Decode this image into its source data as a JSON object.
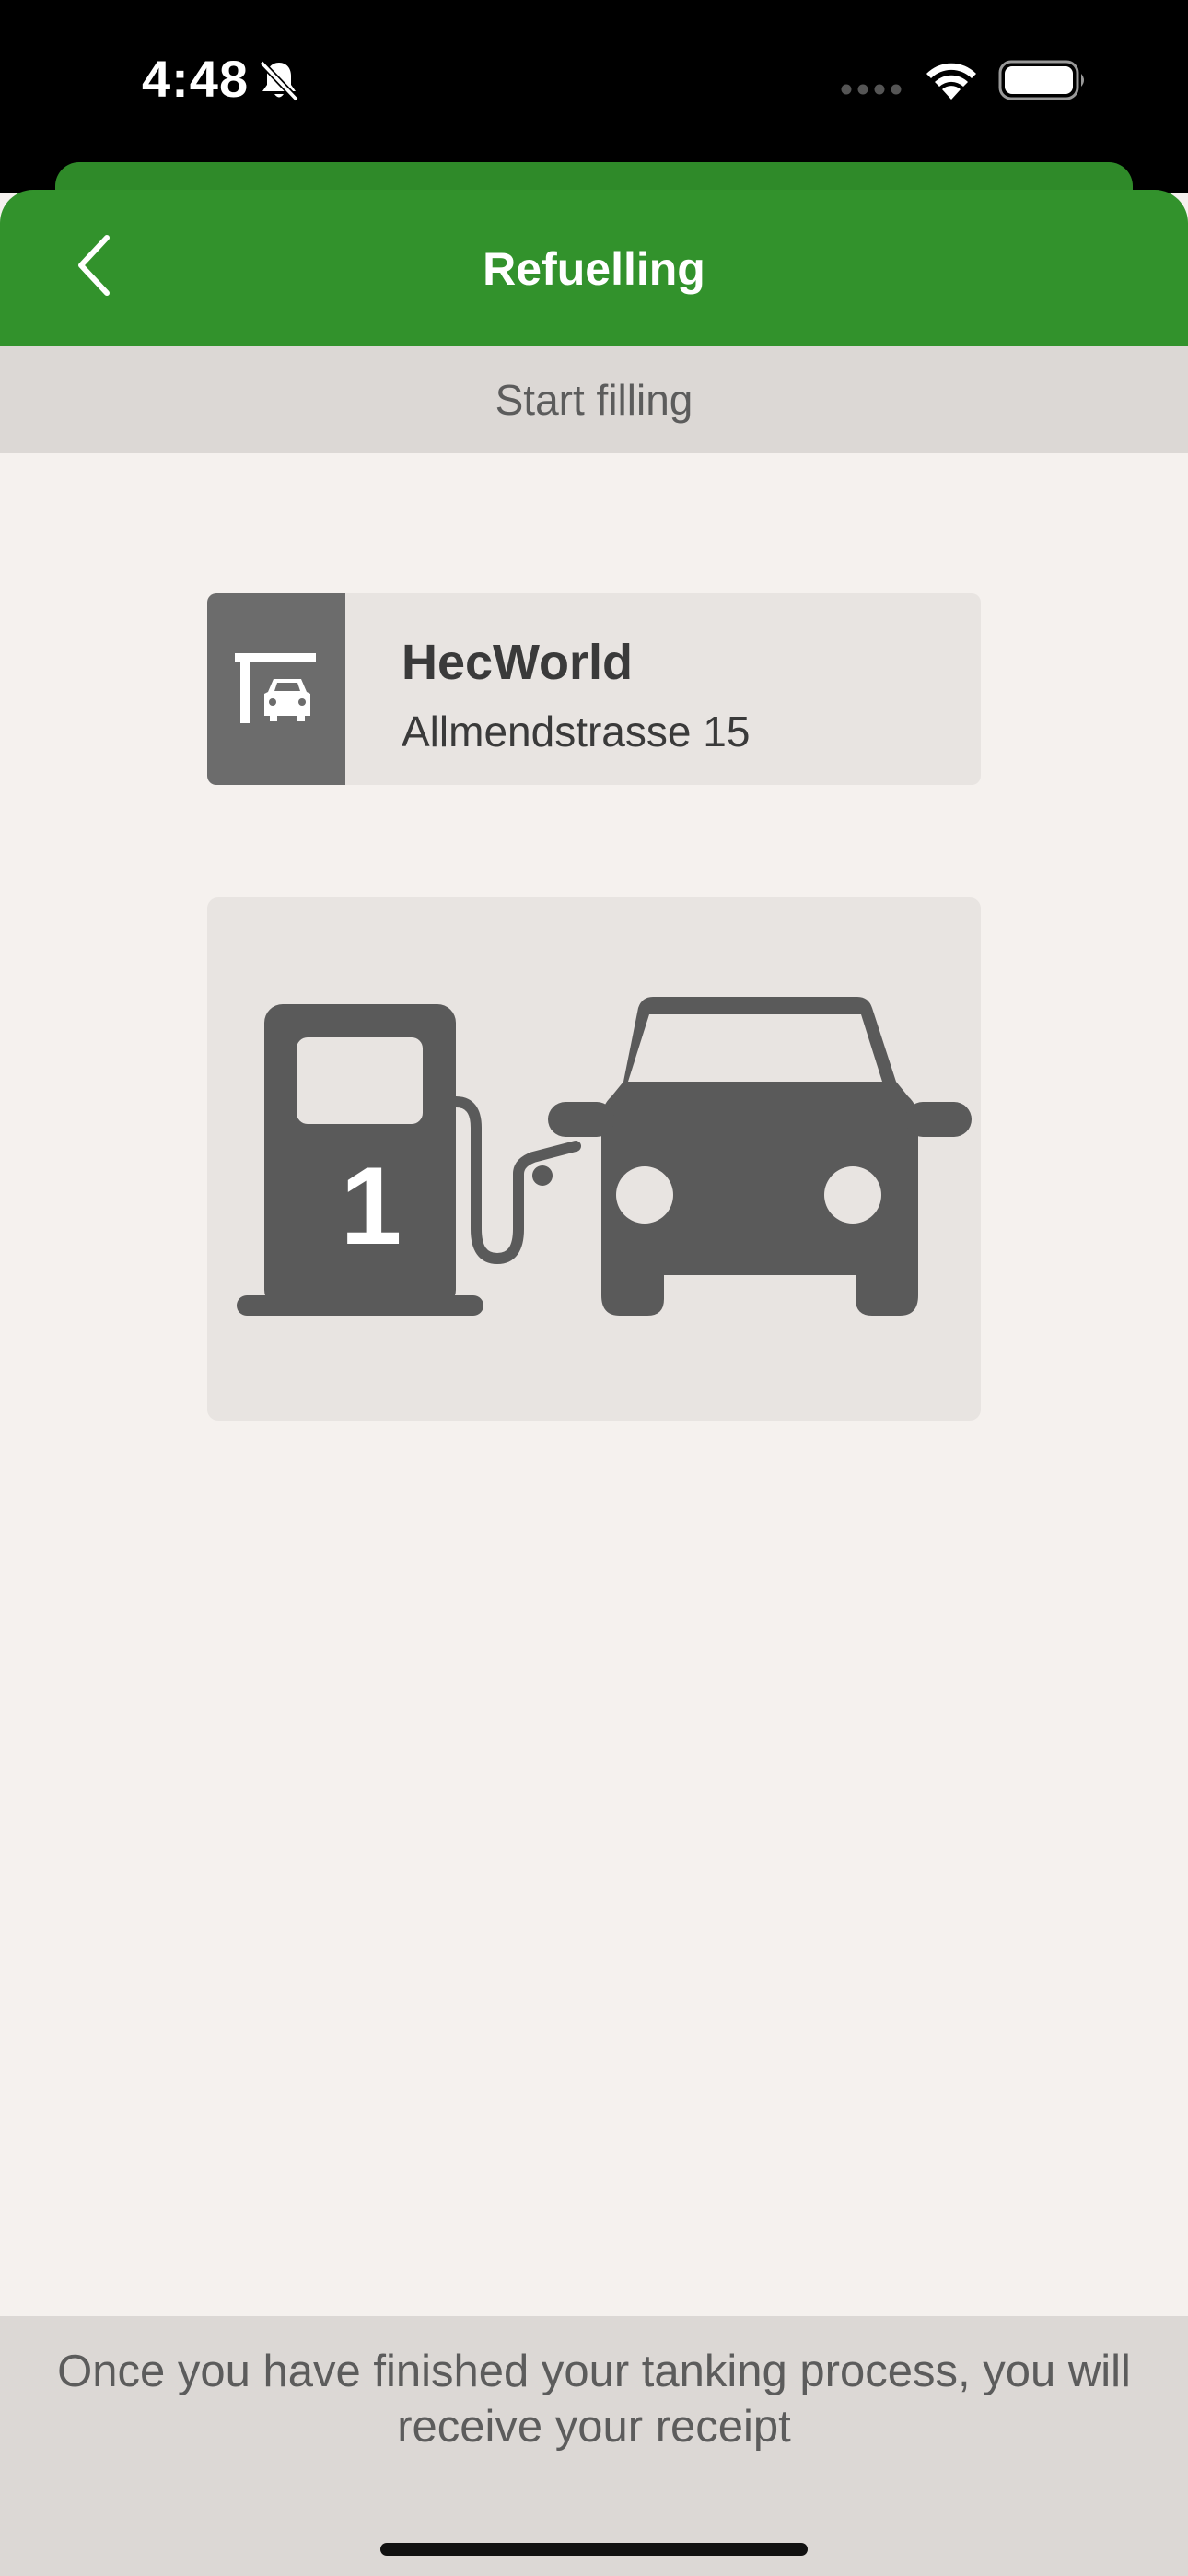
{
  "status_bar": {
    "time": "4:48",
    "icons": [
      "bell-slash-icon",
      "cellular-dots-icon",
      "wifi-icon",
      "battery-icon"
    ]
  },
  "header": {
    "title": "Refuelling",
    "back_icon": "chevron-left-icon"
  },
  "subheader": {
    "label": "Start filling"
  },
  "station": {
    "name": "HecWorld",
    "address": "Allmendstrasse 15",
    "icon": "gas-station-car-icon"
  },
  "pump": {
    "number": "1",
    "illustration_icons": [
      "fuel-pump-icon",
      "car-icon"
    ]
  },
  "footer": {
    "message": "Once you have finished your tanking process, you will receive your receipt"
  },
  "colors": {
    "header_green": "#32922c",
    "sheet_green": "#2f8a29",
    "background": "#f5f1ee",
    "bar_gray": "#dcd8d5",
    "card_gray": "#e8e4e1",
    "icon_dark": "#5a5a5a",
    "text_dark": "#3a3a3a",
    "text_muted": "#5c5c5c"
  }
}
